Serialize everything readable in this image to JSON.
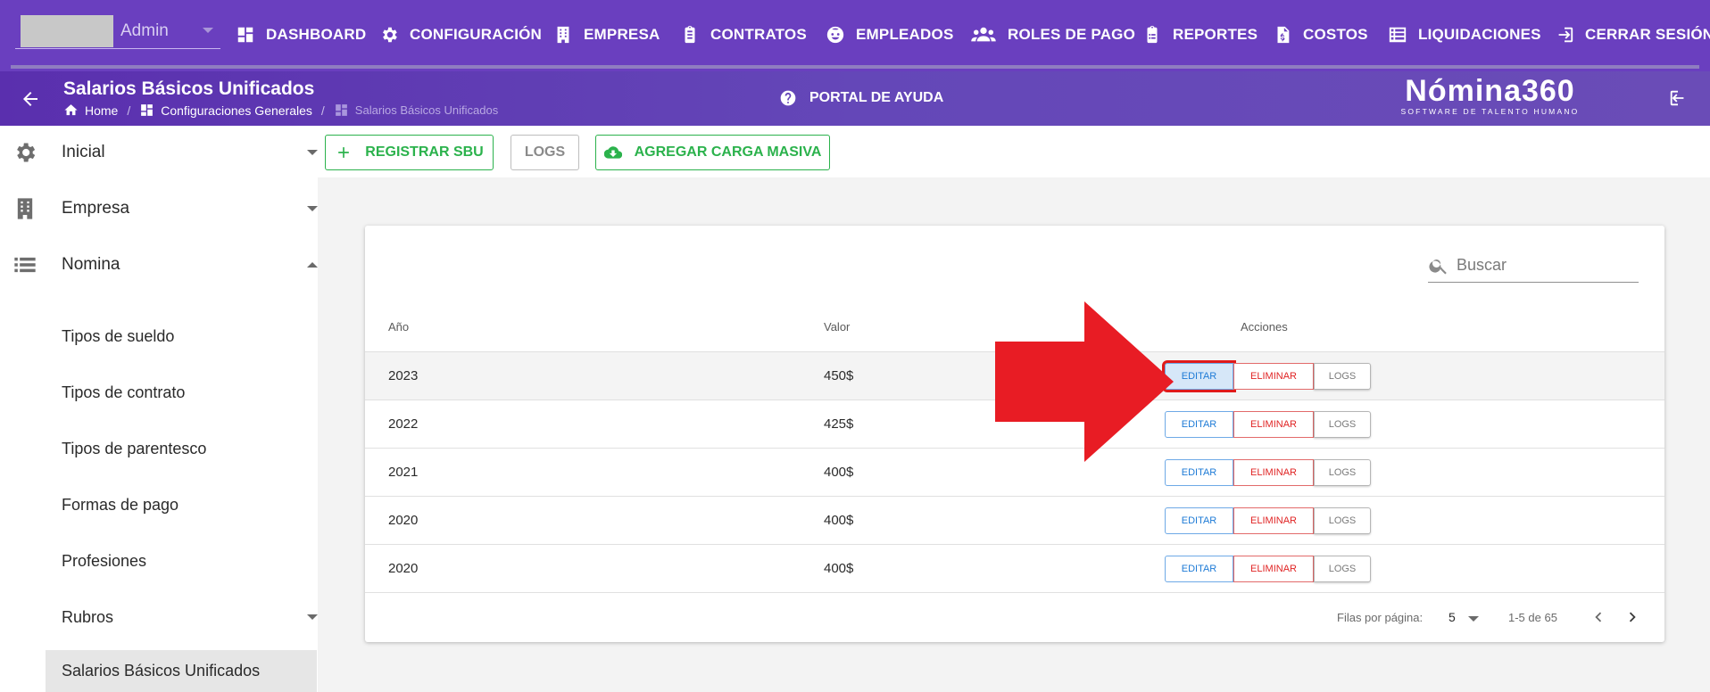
{
  "topnav": {
    "user_name": "Admin",
    "items": [
      {
        "label": "DASHBOARD",
        "icon": "dashboard-icon"
      },
      {
        "label": "CONFIGURACIÓN",
        "icon": "gear-icon"
      },
      {
        "label": "EMPRESA",
        "icon": "building-icon"
      },
      {
        "label": "CONTRATOS",
        "icon": "clipboard-icon"
      },
      {
        "label": "EMPLEADOS",
        "icon": "face-icon"
      },
      {
        "label": "ROLES DE PAGO",
        "icon": "group-icon"
      },
      {
        "label": "REPORTES",
        "icon": "clipboard-list-icon"
      },
      {
        "label": "COSTOS",
        "icon": "invoice-icon"
      },
      {
        "label": "LIQUIDACIONES",
        "icon": "list-icon"
      },
      {
        "label": "CERRAR SESIÓN",
        "icon": "logout-icon"
      }
    ]
  },
  "subheader": {
    "title": "Salarios Básicos Unificados",
    "breadcrumbs": [
      "Home",
      "Configuraciones Generales",
      "Salarios Básicos Unificados"
    ],
    "help": "PORTAL DE AYUDA",
    "logo_main": "Nómina360",
    "logo_sub": "SOFTWARE DE TALENTO HUMANO"
  },
  "sidebar": {
    "groups": [
      {
        "label": "Inicial",
        "icon": "gear-icon",
        "expanded": false
      },
      {
        "label": "Empresa",
        "icon": "building-icon",
        "expanded": false
      },
      {
        "label": "Nomina",
        "icon": "list-icon",
        "expanded": true
      }
    ],
    "subitems": [
      {
        "label": "Tipos de sueldo"
      },
      {
        "label": "Tipos de contrato"
      },
      {
        "label": "Tipos de parentesco"
      },
      {
        "label": "Formas de pago"
      },
      {
        "label": "Profesiones"
      },
      {
        "label": "Rubros"
      },
      {
        "label": "Salarios Básicos Unificados"
      }
    ]
  },
  "toolbar": {
    "register_label": "REGISTRAR SBU",
    "logs_label": "LOGS",
    "bulk_label": "AGREGAR CARGA MASIVA"
  },
  "table": {
    "search_placeholder": "Buscar",
    "headers": [
      "Año",
      "Valor",
      "Acciones"
    ],
    "rows": [
      {
        "year": "2023",
        "value": "450$"
      },
      {
        "year": "2022",
        "value": "425$"
      },
      {
        "year": "2021",
        "value": "400$"
      },
      {
        "year": "2020",
        "value": "400$"
      },
      {
        "year": "2020",
        "value": "400$"
      }
    ],
    "actions": {
      "edit": "EDITAR",
      "delete": "ELIMINAR",
      "logs": "LOGS"
    },
    "pagination": {
      "rows_per_page_label": "Filas por página:",
      "rows_per_page": "5",
      "range": "1-5 de 65"
    }
  },
  "colors": {
    "primary": "#6a3fbf",
    "accent_green": "#2bb24c",
    "edit_blue": "#1e7bd6",
    "delete_red": "#e02424",
    "annotation_red": "#e81c24"
  }
}
